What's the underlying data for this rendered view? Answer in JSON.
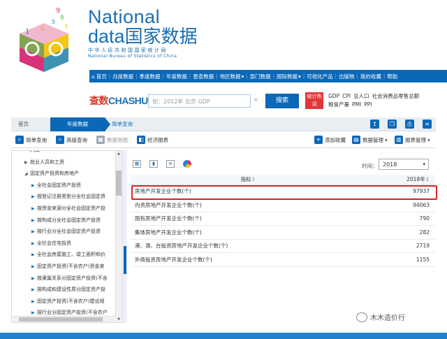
{
  "brand": {
    "line1": "National",
    "line2_en": "data",
    "line2_cn": "国家数据",
    "sub_cn": "中华人民共和国国家统计局",
    "sub_en": "National Bureau of Statistics of China"
  },
  "nav": {
    "items": [
      "首页",
      "月度数据",
      "季度数据",
      "年度数据",
      "普查数据",
      "地区数据",
      "部门数据",
      "国际数据",
      "可视化产品",
      "出版物",
      "我的收藏",
      "帮助"
    ],
    "dropdown_suffix": "▾"
  },
  "search": {
    "logo_cha": "查数",
    "logo_en": "CHASHU",
    "placeholder": "如：2012年 北京 GDP",
    "clear": "×",
    "button": "搜索",
    "hot_label": "统计热词",
    "hot_links": [
      "GDP",
      "CPI",
      "总人口",
      "社会消费品零售总额",
      "粮食产量",
      "PMI",
      "PPI"
    ]
  },
  "breadcrumb": {
    "home": "首页",
    "year": "年度数据",
    "simple": "简单查询"
  },
  "toolbar": {
    "simple_query": "简单查询",
    "advanced_query": "高级查询",
    "data_map": "数据地图",
    "econ_chart": "经济图表",
    "add_fav": "添加收藏",
    "data_manage": "数据管理",
    "report_manage": "报表管理"
  },
  "tree": {
    "items": [
      {
        "label": "人口",
        "level": 1,
        "type": "leaf"
      },
      {
        "label": "就业人员和工资",
        "level": 1,
        "type": "collapsed"
      },
      {
        "label": "固定资产投资和房地产",
        "level": 1,
        "type": "expanded"
      },
      {
        "label": "全社会固定资产投资",
        "level": 2,
        "type": "collapsed"
      },
      {
        "label": "按登记注册类型分全社会固定资",
        "level": 2,
        "type": "collapsed"
      },
      {
        "label": "按资金来源分全社会固定资产投",
        "level": 2,
        "type": "collapsed"
      },
      {
        "label": "按构成分全社会固定资产投资",
        "level": 2,
        "type": "collapsed"
      },
      {
        "label": "按行业分全社会固定资产投资",
        "level": 2,
        "type": "collapsed"
      },
      {
        "label": "全社会住宅投资",
        "level": 2,
        "type": "collapsed"
      },
      {
        "label": "全社会房屋施工、竣工面积和价",
        "level": 2,
        "type": "collapsed"
      },
      {
        "label": "固定资产投资(不含农户)资金来",
        "level": 2,
        "type": "collapsed"
      },
      {
        "label": "按隶属关系分固定资产投资(不含",
        "level": 2,
        "type": "collapsed"
      },
      {
        "label": "按构成和建设性质分固定资产投",
        "level": 2,
        "type": "collapsed"
      },
      {
        "label": "固定资产投资(不含农户)建设规",
        "level": 2,
        "type": "collapsed"
      },
      {
        "label": "按行业分固定资产投资(不含农户",
        "level": 2,
        "type": "collapsed"
      }
    ]
  },
  "panel": {
    "time_label": "时间：",
    "year_value": "2018",
    "header_indicator": "指标",
    "header_year": "2018年",
    "sort_mark": "⇕",
    "rows": [
      {
        "indicator": "房地产开发企业个数(个)",
        "value": "97937"
      },
      {
        "indicator": "内资房地产开发企业个数(个)",
        "value": "94063"
      },
      {
        "indicator": "国有房地产开发企业个数(个)",
        "value": "790"
      },
      {
        "indicator": "集体房地产开发企业个数(个)",
        "value": "282"
      },
      {
        "indicator": "港、澳、台投资房地产开发企业个数(个)",
        "value": "2719"
      },
      {
        "indicator": "外商投资房地产开发企业个数(个)",
        "value": "1155"
      }
    ]
  },
  "watermark": "木木造价行",
  "colors": {
    "brand_blue": "#0b68b8",
    "highlight_red": "#d9262c",
    "hot_red": "#e0373a"
  }
}
